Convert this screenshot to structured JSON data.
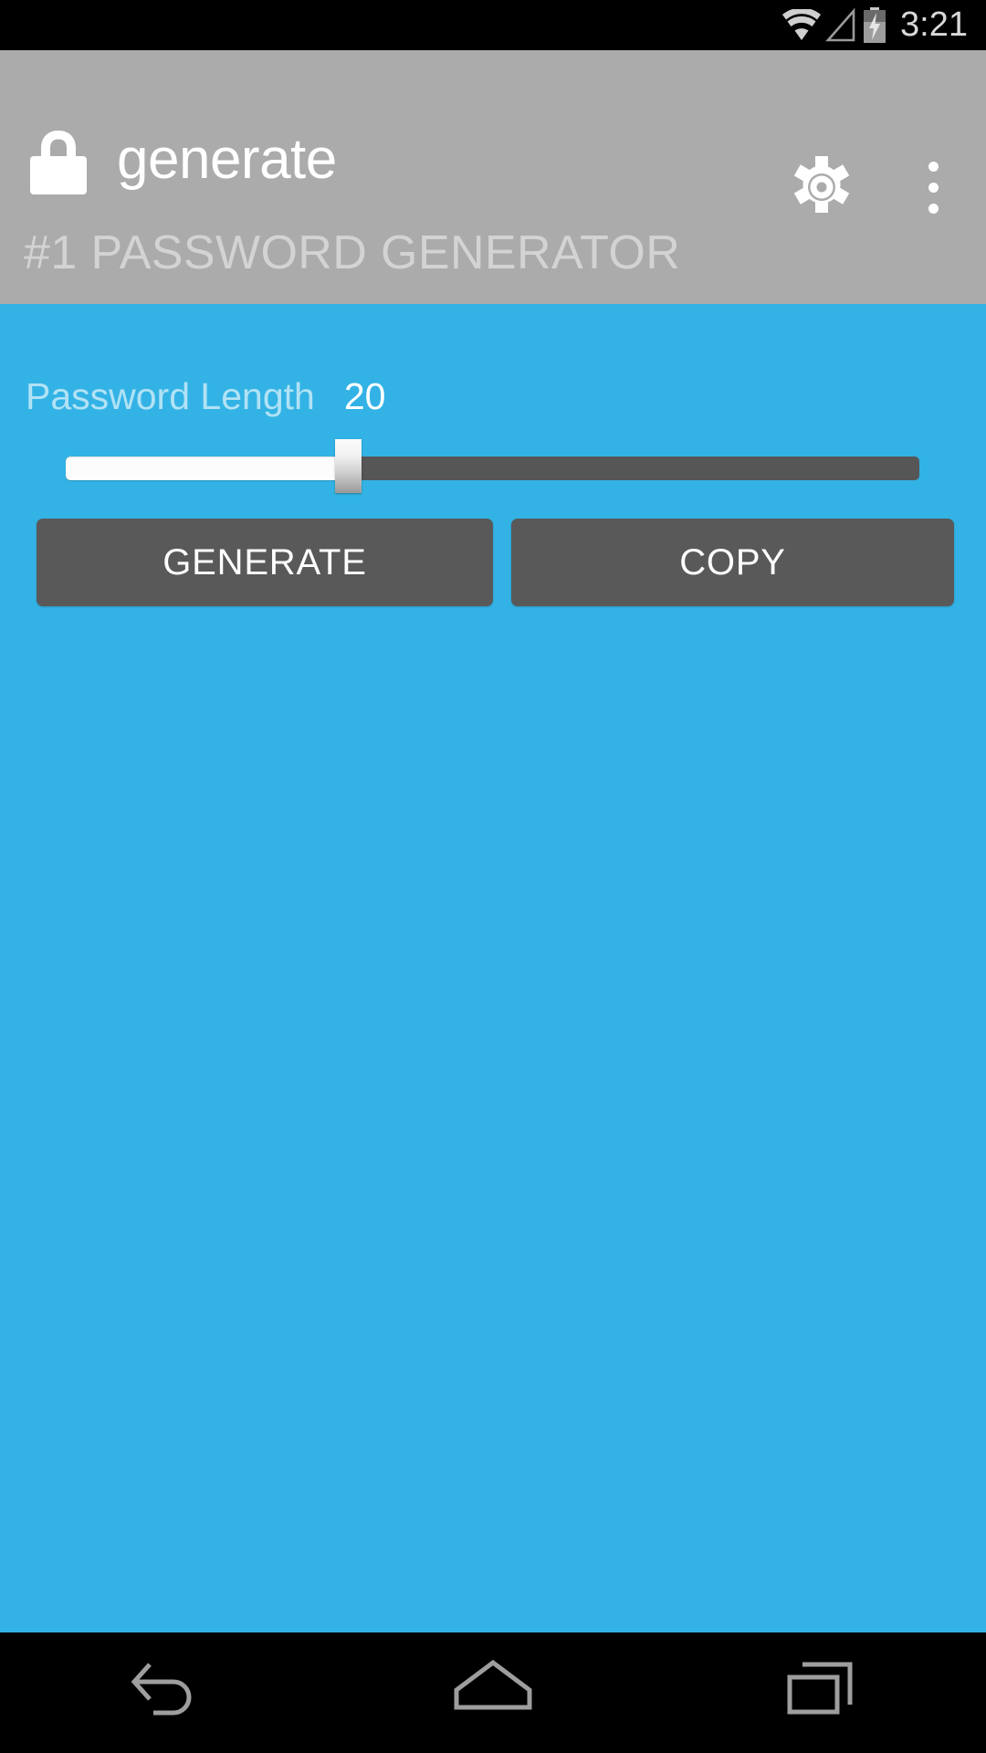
{
  "status_bar": {
    "time": "3:21",
    "icons": [
      "wifi-icon",
      "cell-signal-icon",
      "battery-charging-icon"
    ]
  },
  "app_bar": {
    "icon": "lock-icon",
    "title": "generate",
    "subtitle": "#1 PASSWORD GENERATOR",
    "settings_icon": "gear-icon",
    "overflow_icon": "overflow-menu-icon",
    "background_color": "#ABABAB"
  },
  "content": {
    "background_color": "#33B3E5",
    "password_length": {
      "label": "Password Length",
      "value": "20",
      "slider": {
        "min": 1,
        "max": 64,
        "current": 20,
        "fill_percent": 33,
        "fill_color": "#FCFCFC",
        "track_color": "#565656"
      }
    },
    "buttons": {
      "generate_label": "GENERATE",
      "copy_label": "COPY",
      "button_color": "#595959"
    }
  },
  "nav_bar": {
    "background_color": "#000000",
    "items": [
      {
        "name": "back-nav-button",
        "icon": "back-arrow-icon"
      },
      {
        "name": "home-nav-button",
        "icon": "home-icon"
      },
      {
        "name": "recents-nav-button",
        "icon": "recents-icon"
      }
    ]
  }
}
